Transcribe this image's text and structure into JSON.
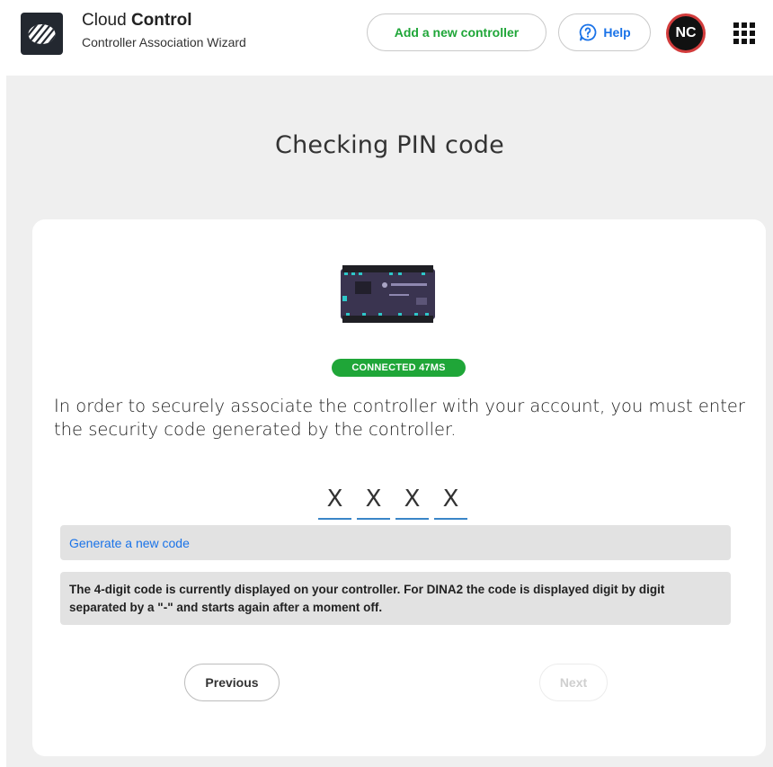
{
  "header": {
    "title_prefix": "Cloud",
    "title_bold": "Control",
    "subtitle": "Controller Association Wizard",
    "add_controller_label": "Add a new controller",
    "help_label": "Help",
    "avatar_initials": "NC"
  },
  "page": {
    "title": "Checking PIN code"
  },
  "card": {
    "status_badge": "CONNECTED 47MS",
    "instructions": "In order to securely associate the controller with your account, you must enter the security code generated by the controller.",
    "pin_placeholders": [
      "X",
      "X",
      "X",
      "X"
    ],
    "generate_link": "Generate a new code",
    "info_text": "The 4-digit code is currently displayed on your controller. For DINA2 the code is displayed digit by digit separated by a \"-\" and starts again after a moment off.",
    "previous_label": "Previous",
    "next_label": "Next"
  },
  "colors": {
    "accent_green": "#1fa638",
    "link_blue": "#1a73e8",
    "avatar_ring": "#d23c3c",
    "pin_underline": "#3a85c7"
  },
  "icons": {
    "logo": "cloud-logo-icon",
    "help": "help-question-icon",
    "apps": "apps-grid-icon",
    "device": "controller-device-image"
  }
}
